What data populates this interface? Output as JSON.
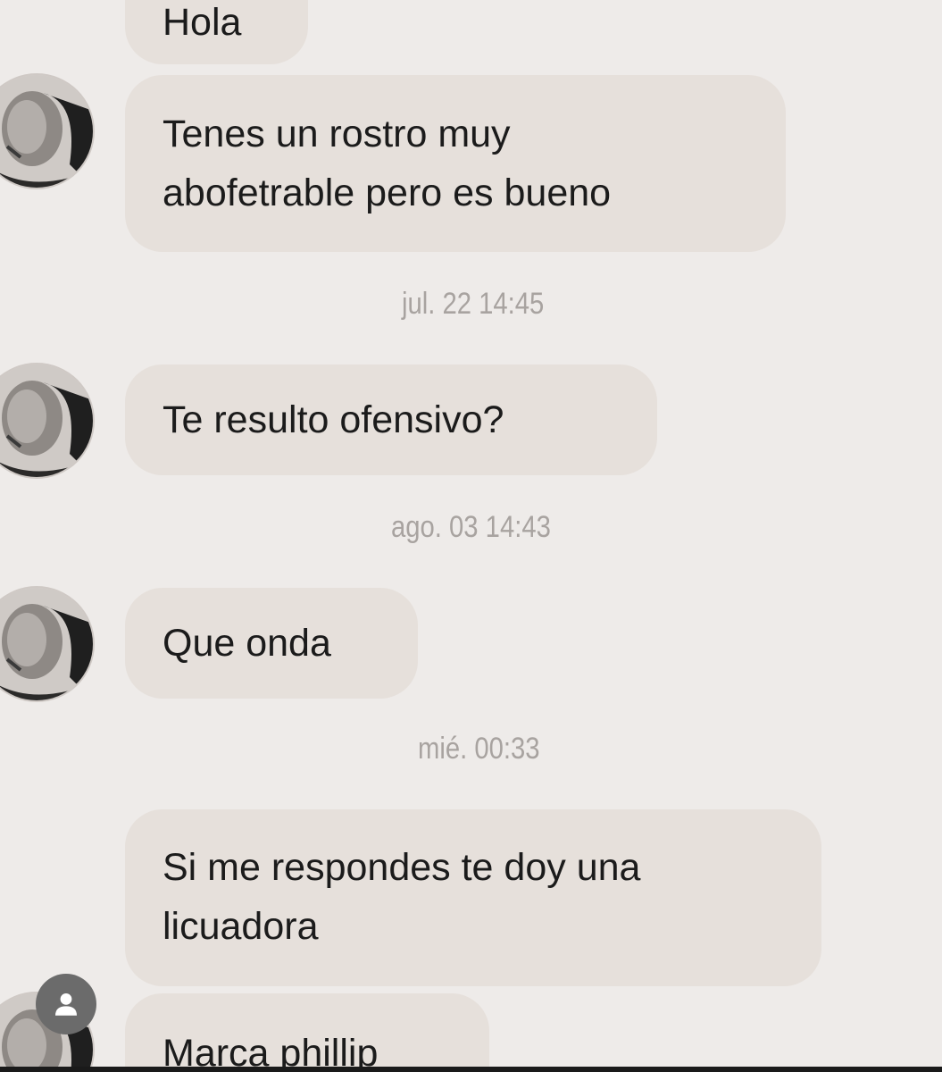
{
  "messages": [
    {
      "id": "m1",
      "text": "Hola"
    },
    {
      "id": "m2",
      "lines": [
        "Tenes un rostro muy",
        "abofetrable pero es bueno"
      ]
    },
    {
      "id": "m3",
      "text": "Te resulto ofensivo?"
    },
    {
      "id": "m4",
      "text": "Que onda"
    },
    {
      "id": "m5",
      "lines": [
        "Si me respondes te doy una",
        "licuadora"
      ]
    },
    {
      "id": "m6",
      "text": "Marca phillip"
    }
  ],
  "timestamps": {
    "t1": "jul. 22 14:45",
    "t2": "ago. 03 14:43",
    "t3": "mié. 00:33"
  },
  "icons": {
    "avatar": "sender-avatar-photo",
    "profile": "person-icon"
  },
  "colors": {
    "background": "#eeebe9",
    "bubble": "#e6e0db",
    "timestamp": "#a8a3a0"
  }
}
